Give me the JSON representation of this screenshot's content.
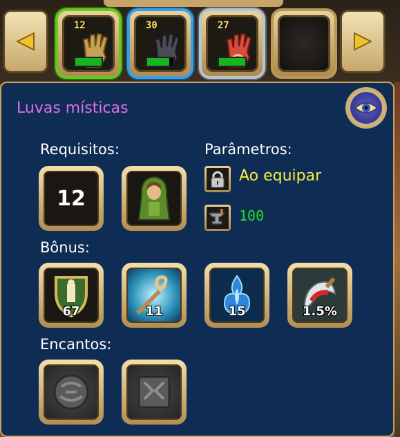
{
  "colors": {
    "panel": "#0f2c55",
    "title": "#e070e6",
    "highlight": "#f6ef42",
    "value_green": "#22e022",
    "frame_gold": "#c8a35f"
  },
  "carousel": {
    "prev_icon": "arrow-left-icon",
    "next_icon": "arrow-right-icon",
    "slots": [
      {
        "level": "12",
        "item": "gloves-tan-icon",
        "rarity": "green",
        "durability": 1.0
      },
      {
        "level": "30",
        "item": "gloves-dark-icon",
        "rarity": "blue",
        "durability": 0.85
      },
      {
        "level": "27",
        "item": "gloves-red-icon",
        "rarity": "silver",
        "durability": 1.0
      },
      {
        "level": "",
        "item": "empty-slot",
        "rarity": "none",
        "durability": null
      }
    ]
  },
  "item": {
    "name": "Luvas místicas",
    "eye_icon": "eye-icon"
  },
  "requirements": {
    "label": "Requisitos:",
    "level": "12",
    "class_icon": "hooded-character-icon"
  },
  "parameters": {
    "label": "Parâmetros:",
    "bind_text": "Ao equipar",
    "bind_icon": "lock-icon",
    "anvil_icon": "anvil-icon",
    "value": "100"
  },
  "bonus": {
    "label": "Bônus:",
    "items": [
      {
        "icon": "shield-icon",
        "value": "67"
      },
      {
        "icon": "staff-spiral-icon",
        "value": "11"
      },
      {
        "icon": "blue-flame-icon",
        "value": "15"
      },
      {
        "icon": "crit-blade-icon",
        "value": "1.5%"
      }
    ]
  },
  "enchants": {
    "label": "Encantos:",
    "items": [
      {
        "icon": "stone-rune-round-icon"
      },
      {
        "icon": "stone-rune-square-icon"
      }
    ]
  }
}
